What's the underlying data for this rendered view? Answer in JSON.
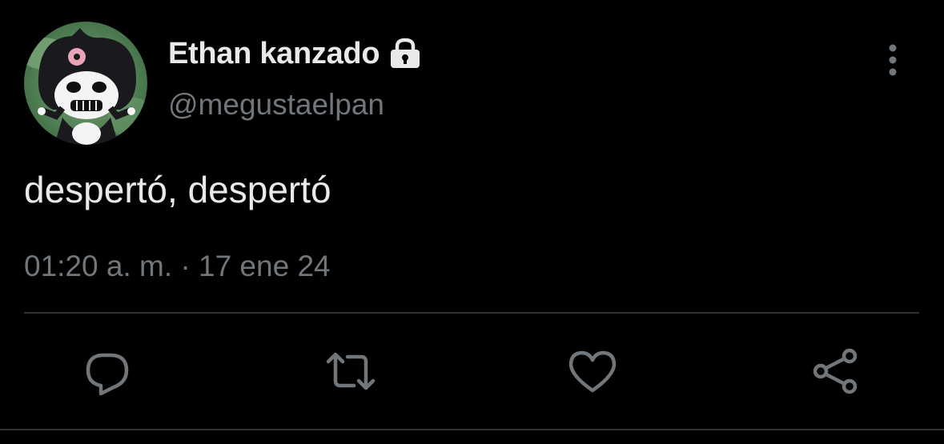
{
  "tweet": {
    "display_name": "Ethan kanzado",
    "handle": "@megustaelpan",
    "text": "despertó, despertó",
    "timestamp": "01:20 a. m.",
    "separator": "·",
    "date": "17 ene 24",
    "protected": true
  },
  "icons": {
    "protected": "lock-icon",
    "more": "more-vertical-icon",
    "reply": "reply-icon",
    "retweet": "retweet-icon",
    "like": "heart-icon",
    "share": "share-icon"
  },
  "colors": {
    "background": "#000000",
    "primary_text": "#e7e9ea",
    "secondary_text": "#71767b",
    "divider": "#2f3336"
  }
}
